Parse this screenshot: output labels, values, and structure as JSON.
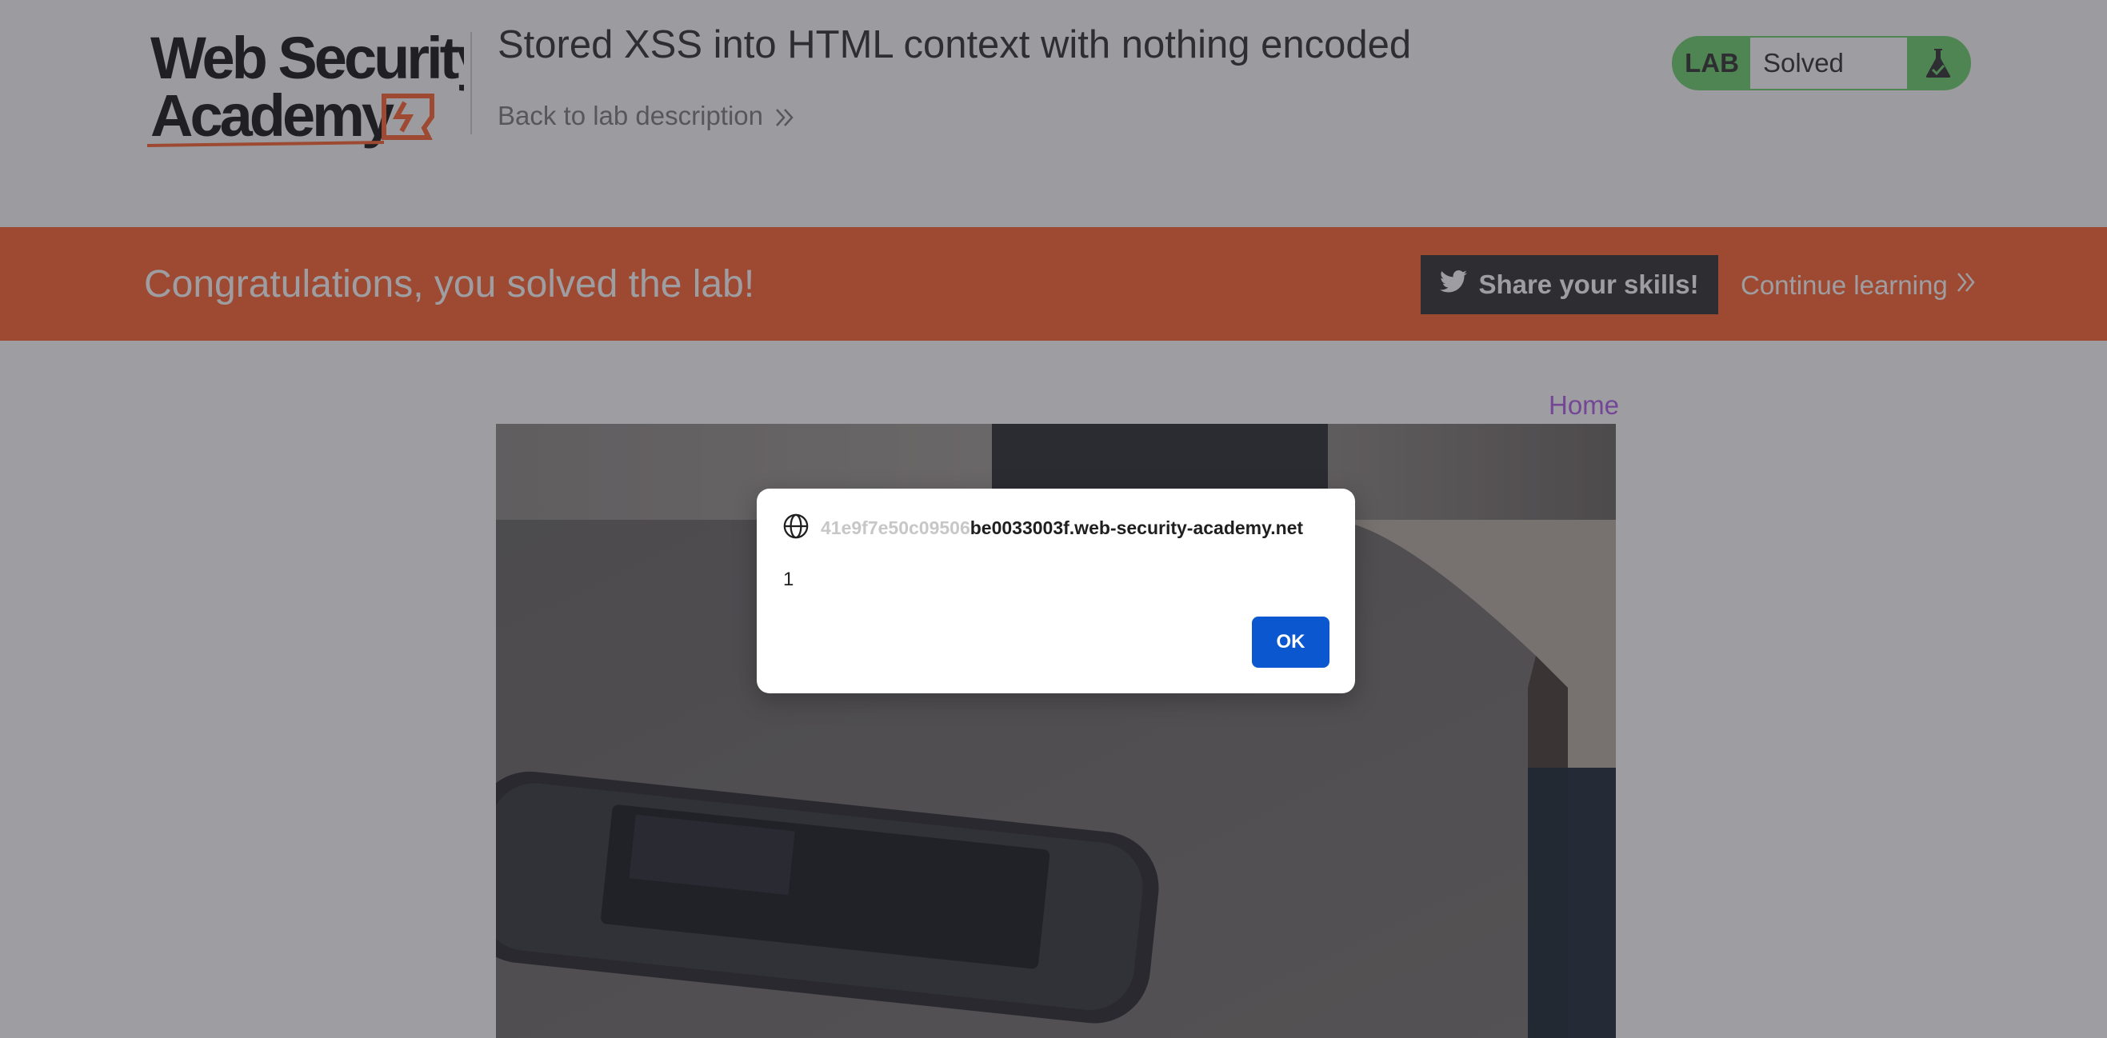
{
  "header": {
    "logo_text": "Web Security Academy",
    "lab_title": "Stored XSS into HTML context with nothing encoded",
    "back_link": "Back to lab description"
  },
  "status": {
    "badge": "LAB",
    "state": "Solved",
    "icon": "flask-icon",
    "color": "#70d16d"
  },
  "banner": {
    "message": "Congratulations, you solved the lab!",
    "share_button": "Share your skills!",
    "continue_link": "Continue learning",
    "color": "#ff6633"
  },
  "nav": {
    "home": "Home"
  },
  "dialog": {
    "origin_prefix": "41e9f7e50c09506",
    "origin_rest": "be0033003f.web-security-academy.net",
    "message": "1",
    "ok_button": "OK",
    "ok_color": "#0b57d0"
  }
}
